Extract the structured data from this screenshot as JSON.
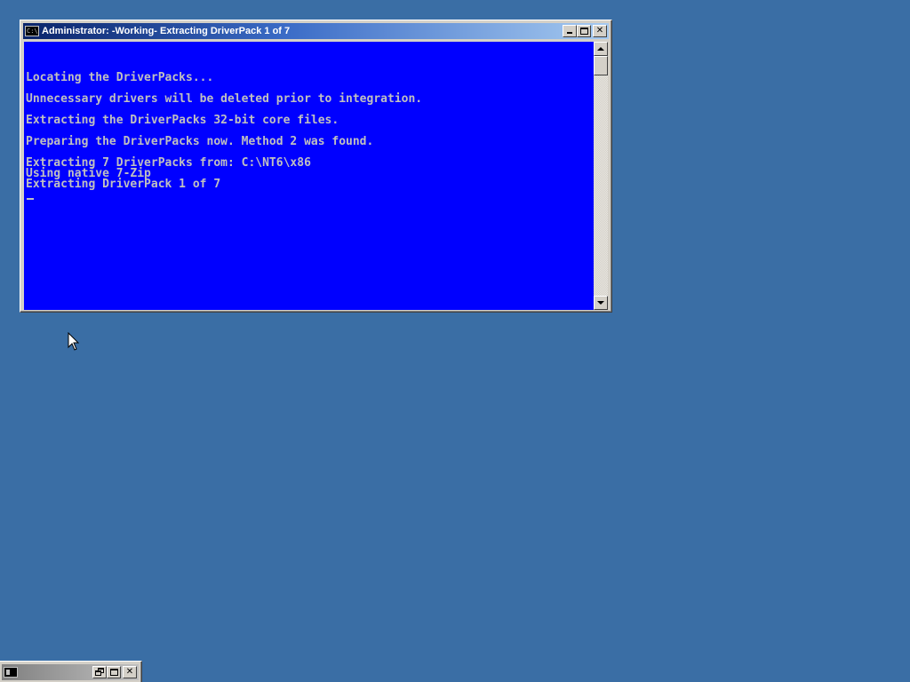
{
  "window": {
    "title": "Administrator:  -Working- Extracting DriverPack 1 of 7",
    "icon": "console-icon",
    "buttons": {
      "minimize": "minimize-icon",
      "maximize": "maximize-icon",
      "close": "close-icon"
    }
  },
  "console": {
    "lines": [
      "Locating the DriverPacks...",
      "",
      "Unnecessary drivers will be deleted prior to integration.",
      "",
      "Extracting the DriverPacks 32-bit core files.",
      "",
      "Preparing the DriverPacks now. Method 2 was found.",
      "",
      "Extracting 7 DriverPacks from: C:\\NT6\\x86",
      "Using native 7-Zip",
      "Extracting DriverPack 1 of 7"
    ],
    "background": "#0000ff",
    "foreground": "#c0c0c0"
  },
  "minimized_window": {
    "icon": "console-icon",
    "buttons": {
      "restore": "restore-icon",
      "maximize": "maximize-icon",
      "close": "close-icon"
    }
  },
  "colors": {
    "desktop": "#3a6ea5",
    "titlebar_active_start": "#0a246a",
    "titlebar_active_end": "#a6caf0"
  }
}
